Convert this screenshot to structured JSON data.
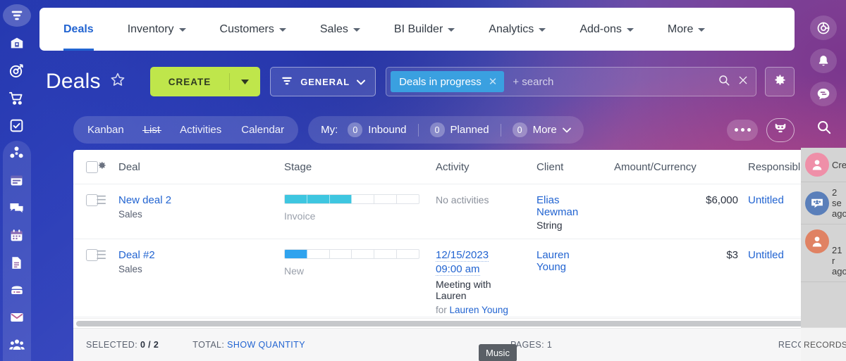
{
  "theme": {
    "accent_green": "#bfe64b",
    "accent_blue": "#2264d1",
    "chip_blue": "#3aa0e0",
    "bar_cyan": "#3ec6e0",
    "bar_blue": "#2fa3ee"
  },
  "left_rail": [
    {
      "name": "filter-icon",
      "active": true
    },
    {
      "name": "warehouse-icon",
      "active": false
    },
    {
      "name": "target-icon",
      "active": false
    },
    {
      "name": "cart-icon",
      "active": false
    },
    {
      "name": "task-check-icon",
      "active": false
    },
    {
      "name": "automation-icon",
      "active": false
    },
    {
      "name": "sites-icon",
      "active": false
    },
    {
      "name": "chat-icon",
      "active": false
    },
    {
      "name": "calendar-icon",
      "active": false
    },
    {
      "name": "document-icon",
      "active": false
    },
    {
      "name": "drive-icon",
      "active": false
    },
    {
      "name": "mail-icon",
      "active": false
    },
    {
      "name": "company-icon",
      "active": false
    }
  ],
  "right_rail": [
    {
      "name": "support-icon"
    },
    {
      "name": "notification-bell-icon"
    },
    {
      "name": "message-icon"
    },
    {
      "name": "search-icon"
    }
  ],
  "right_panel": {
    "rows": [
      {
        "avatar": "user-pink",
        "text": "Cre"
      },
      {
        "avatar": "group-blue",
        "text": "2 se\nago"
      },
      {
        "avatar": "user-orange",
        "text": "21 r\nago"
      }
    ],
    "records_label": "RECORDS:"
  },
  "topnav": {
    "items": [
      {
        "label": "Deals",
        "has_chevron": false,
        "active": true
      },
      {
        "label": "Inventory",
        "has_chevron": true,
        "active": false
      },
      {
        "label": "Customers",
        "has_chevron": true,
        "active": false
      },
      {
        "label": "Sales",
        "has_chevron": true,
        "active": false
      },
      {
        "label": "BI Builder",
        "has_chevron": true,
        "active": false
      },
      {
        "label": "Analytics",
        "has_chevron": true,
        "active": false
      },
      {
        "label": "Add-ons",
        "has_chevron": true,
        "active": false
      },
      {
        "label": "More",
        "has_chevron": true,
        "active": false
      }
    ]
  },
  "header": {
    "title": "Deals",
    "star_icon": "star-outline-icon",
    "create_label": "CREATE",
    "create_caret": "caret-down-icon",
    "filter_label": "GENERAL",
    "filter_icon": "funnel-icon",
    "search": {
      "chip_label": "Deals in progress",
      "chip_close_icon": "close-icon",
      "placeholder": "+ search",
      "search_icon": "search-icon",
      "clear_icon": "clear-icon"
    },
    "settings_icon": "gear-icon"
  },
  "subnav": {
    "view_tabs": [
      {
        "label": "Kanban",
        "active": false
      },
      {
        "label": "List",
        "active": true
      },
      {
        "label": "Activities",
        "active": false
      },
      {
        "label": "Calendar",
        "active": false
      }
    ],
    "my_label": "My:",
    "counters": [
      {
        "count": "0",
        "label": "Inbound"
      },
      {
        "count": "0",
        "label": "Planned"
      },
      {
        "count": "0",
        "label": "More",
        "has_chevron": true
      }
    ],
    "more_button_icon": "ellipsis-icon",
    "bot_button_icon": "robot-icon"
  },
  "table": {
    "headers": {
      "gear_icon": "gear-icon",
      "deal": "Deal",
      "stage": "Stage",
      "activity": "Activity",
      "client": "Client",
      "amount": "Amount/Currency",
      "responsible": "Responsible"
    },
    "rows": [
      {
        "deal_name": "New deal 2",
        "deal_sub": "Sales",
        "stage_label": "Invoice",
        "stage_segments": 6,
        "stage_filled": 3,
        "stage_color": "#3ec6e0",
        "activity_lines": [
          {
            "text": "No activities",
            "style": "muted"
          }
        ],
        "client_lines": [
          {
            "text": "Elias",
            "style": "link"
          },
          {
            "text": "Newman",
            "style": "link"
          },
          {
            "text": "String",
            "style": "dark"
          }
        ],
        "amount": "$6,000",
        "responsible": "Untitled"
      },
      {
        "deal_name": "Deal #2",
        "deal_sub": "Sales",
        "stage_label": "New",
        "stage_segments": 6,
        "stage_filled": 1,
        "stage_color": "#2fa3ee",
        "activity_lines": [
          {
            "text": "12/15/2023",
            "style": "link-dotted"
          },
          {
            "text": "09:00 am",
            "style": "link-dotted"
          },
          {
            "text": "Meeting with",
            "style": "dark"
          },
          {
            "text": "Lauren",
            "style": "dark"
          },
          {
            "text": "for Lauren Young",
            "style": "for"
          }
        ],
        "client_lines": [
          {
            "text": "Lauren",
            "style": "link"
          },
          {
            "text": "Young",
            "style": "link"
          }
        ],
        "amount": "$3",
        "responsible": "Untitled"
      }
    ]
  },
  "footer": {
    "selected_label": "SELECTED:",
    "selected_value": "0 / 2",
    "total_label": "TOTAL:",
    "total_action": "SHOW QUANTITY",
    "pages_label": "PAGES:",
    "pages_value": "1",
    "records_label": "RECORDS:"
  },
  "tooltip": {
    "text": "Music"
  }
}
